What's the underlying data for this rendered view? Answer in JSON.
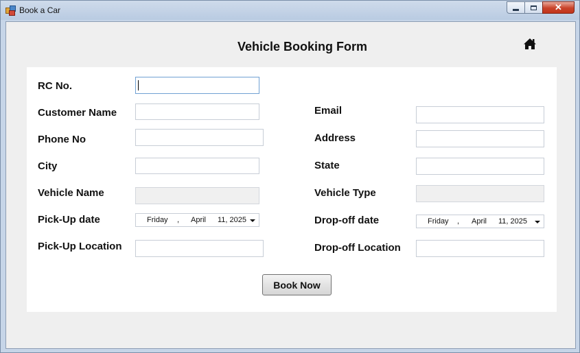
{
  "window": {
    "title": "Book a Car"
  },
  "titlebar_controls": {
    "minimize_icon": "minimize-icon",
    "maximize_icon": "maximize-icon",
    "close_icon": "close-icon",
    "close_glyph": "✕"
  },
  "header": {
    "title": "Vehicle Booking Form",
    "home_icon": "home-icon"
  },
  "fields": {
    "rc_no": {
      "label": "RC No.",
      "value": ""
    },
    "customer_name": {
      "label": "Customer Name",
      "value": ""
    },
    "email": {
      "label": "Email",
      "value": ""
    },
    "phone_no": {
      "label": "Phone No",
      "value": ""
    },
    "address": {
      "label": "Address",
      "value": ""
    },
    "city": {
      "label": "City",
      "value": ""
    },
    "state": {
      "label": "State",
      "value": ""
    },
    "vehicle_name": {
      "label": "Vehicle Name",
      "value": ""
    },
    "vehicle_type": {
      "label": "Vehicle Type",
      "value": ""
    },
    "pickup_date": {
      "label": "Pick-Up date",
      "weekday": "Friday",
      "sep": ",",
      "month": "April",
      "day_year": "11, 2025"
    },
    "dropoff_date": {
      "label": "Drop-off date",
      "weekday": "Friday",
      "sep": ",",
      "month": "April",
      "day_year": "11, 2025"
    },
    "pickup_location": {
      "label": "Pick-Up Location",
      "value": ""
    },
    "dropoff_location": {
      "label": "Drop-off Location",
      "value": ""
    }
  },
  "actions": {
    "book_now": "Book Now"
  }
}
